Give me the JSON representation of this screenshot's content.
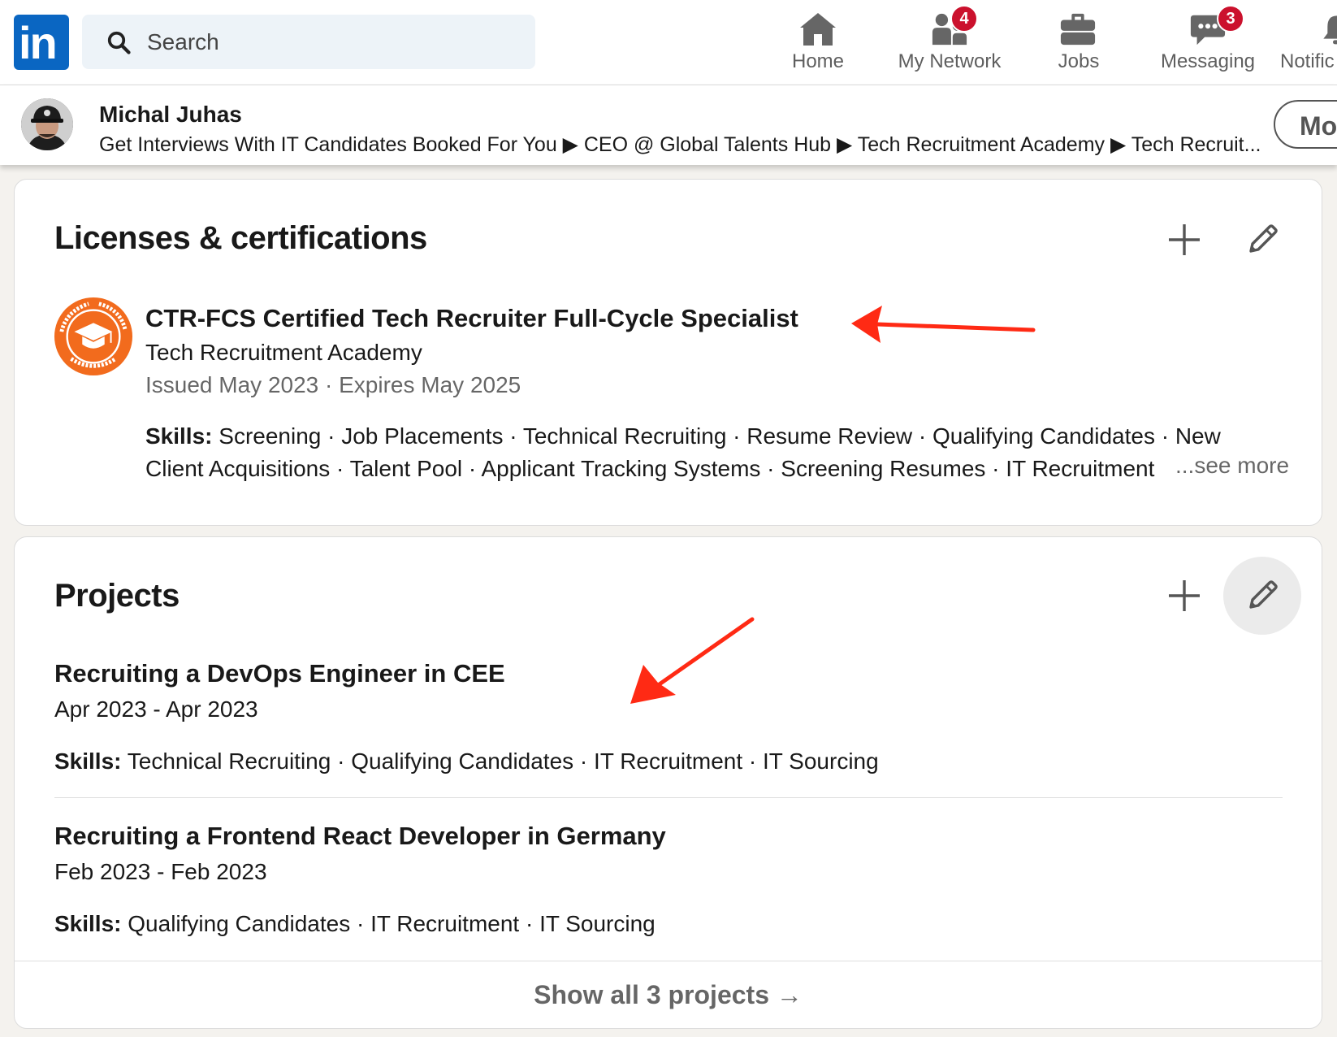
{
  "nav": {
    "search_placeholder": "Search",
    "items": [
      {
        "label": "Home",
        "icon": "home-icon"
      },
      {
        "label": "My Network",
        "icon": "network-icon",
        "badge": "4"
      },
      {
        "label": "Jobs",
        "icon": "briefcase-icon"
      },
      {
        "label": "Messaging",
        "icon": "messaging-icon",
        "badge": "3"
      },
      {
        "label": "Notific",
        "icon": "bell-icon"
      }
    ]
  },
  "profile": {
    "name": "Michal Juhas",
    "headline": "Get Interviews With IT Candidates Booked For You ▶ CEO @ Global Talents Hub ▶ Tech Recruitment Academy ▶ Tech Recruit...",
    "more_button": "Mo"
  },
  "licenses": {
    "title": "Licenses & certifications",
    "item": {
      "title": "CTR-FCS Certified Tech Recruiter Full-Cycle Specialist",
      "issuer": "Tech Recruitment Academy",
      "dates": "Issued May 2023 · Expires May 2025",
      "skills_label": "Skills:",
      "skills": "Screening · Job Placements · Technical Recruiting · Resume Review · Qualifying Candidates · New Client Acquisitions · Talent Pool · Applicant Tracking Systems · Screening Resumes · IT Recruitment",
      "see_more": "...see more"
    },
    "logo_text_top": "Tech Recruitment Academy",
    "logo_text_bottom": "THRIVE in IT"
  },
  "projects": {
    "title": "Projects",
    "items": [
      {
        "title": "Recruiting a DevOps Engineer in CEE",
        "dates": "Apr 2023 - Apr 2023",
        "skills_label": "Skills:",
        "skills": "Technical Recruiting · Qualifying Candidates · IT Recruitment · IT Sourcing"
      },
      {
        "title": "Recruiting a Frontend React Developer in Germany",
        "dates": "Feb 2023 - Feb 2023",
        "skills_label": "Skills:",
        "skills": "Qualifying Candidates · IT Recruitment · IT Sourcing"
      }
    ],
    "show_all": "Show all 3 projects →"
  },
  "colors": {
    "brand": "#0a66c2",
    "badge": "#cb112d",
    "annotation_arrow": "#ff2a14",
    "logo_orange": "#f26b1d"
  }
}
